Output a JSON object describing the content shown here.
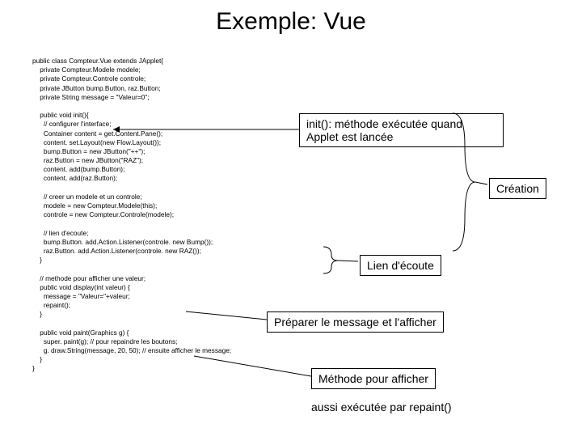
{
  "title": "Exemple: Vue",
  "code": "public class Compteur.Vue extends JApplet{\n    private Compteur.Modele modele;\n    private Compteur.Controle controle;\n    private JButton bump.Button, raz.Button;\n    private String message = \"Valeur=0\";\n\n    public void init(){\n      // configurer l'interface;\n      Container content = get.Content.Pane();\n      content. set.Layout(new Flow.Layout());\n      bump.Button = new JButton(\"++\");\n      raz.Button = new JButton(\"RAZ\");\n      content. add(bump.Button);\n      content. add(raz.Button);\n\n      // creer un modele et un controle;\n      modele = new Compteur.Modele(this);\n      controle = new Compteur.Controle(modele);\n\n      // lien d'ecoute;\n      bump.Button. add.Action.Listener(controle. new Bump());\n      raz.Button. add.Action.Listener(controle. new RAZ());\n    }\n\n    // methode pour afficher une valeur;\n    public void display(int valeur) {\n      message = \"Valeur=\"+valeur;\n      repaint();\n    }\n\n    public void paint(Graphics g) {\n      super. paint(g); // pour repaindre les boutons;\n      g. draw.String(message, 20, 50); // ensuite afficher le message;\n    }\n}",
  "annot_init": "init(): méthode exécutée quand\nApplet est lancée",
  "annot_creation": "Création",
  "annot_lien": "Lien d'écoute",
  "annot_preparer": "Préparer le message et l'afficher",
  "annot_methode": "Méthode pour afficher",
  "annot_aussi": "aussi exécutée par repaint()"
}
